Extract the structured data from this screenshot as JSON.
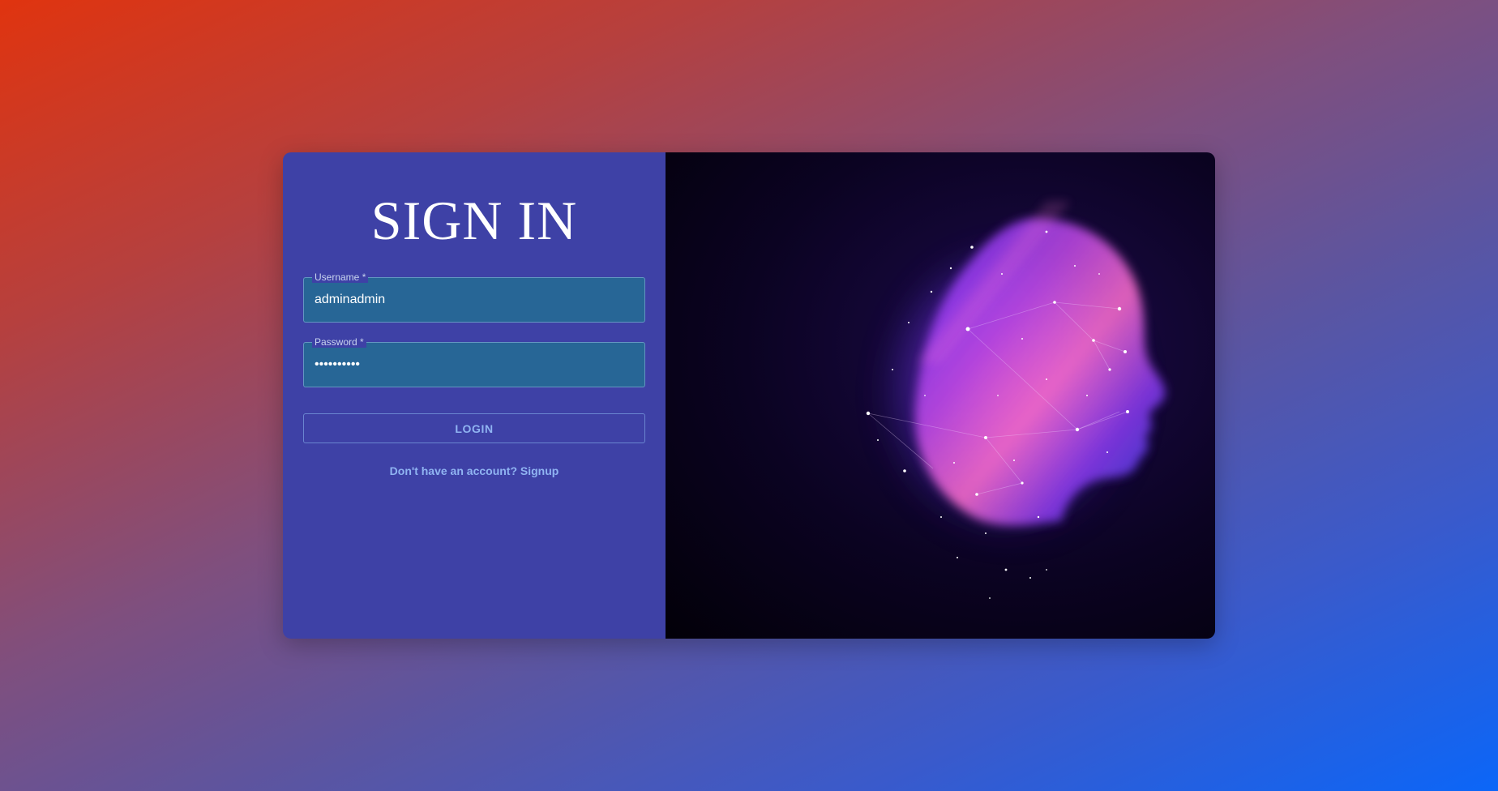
{
  "login_form": {
    "title": "SIGN IN",
    "username": {
      "label": "Username *",
      "value": "adminadmin"
    },
    "password": {
      "label": "Password *",
      "value": "••••••••••"
    },
    "login_button_label": "LOGIN",
    "signup_link_text": "Don't have an account? Signup"
  },
  "illustration": {
    "subject": "head-silhouette-with-constellation"
  },
  "colors": {
    "form_panel": "#3e41a6",
    "input_fill": "#276696",
    "accent_text": "#90b4f2",
    "image_background": "#0b0322"
  }
}
